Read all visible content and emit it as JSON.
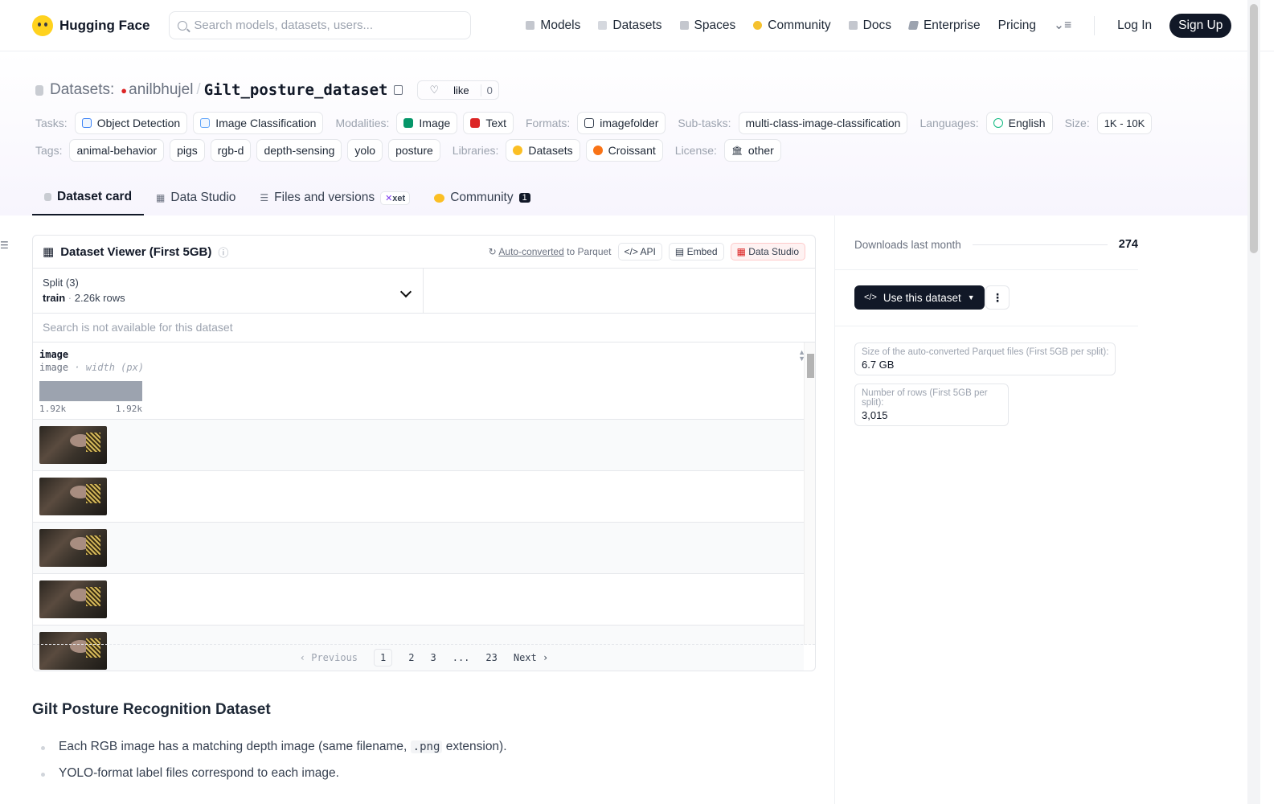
{
  "nav": {
    "brand": "Hugging Face",
    "search_placeholder": "Search models, datasets, users...",
    "links": [
      "Models",
      "Datasets",
      "Spaces",
      "Community",
      "Docs",
      "Enterprise",
      "Pricing"
    ],
    "login": "Log In",
    "signup": "Sign Up"
  },
  "header": {
    "section": "Datasets:",
    "owner": "anilbhujel",
    "separator": "/",
    "repo": "Gilt_posture_dataset",
    "like_label": "like",
    "like_count": "0"
  },
  "tags": {
    "tasks_label": "Tasks:",
    "tasks": [
      "Object Detection",
      "Image Classification"
    ],
    "modalities_label": "Modalities:",
    "modalities": [
      "Image",
      "Text"
    ],
    "formats_label": "Formats:",
    "format": "imagefolder",
    "subtasks_label": "Sub-tasks:",
    "subtask": "multi-class-image-classification",
    "languages_label": "Languages:",
    "language": "English",
    "size_label": "Size:",
    "size": "1K - 10K",
    "tags_label": "Tags:",
    "tags": [
      "animal-behavior",
      "pigs",
      "rgb-d",
      "depth-sensing",
      "yolo",
      "posture"
    ],
    "libraries_label": "Libraries:",
    "libraries": [
      "Datasets",
      "Croissant"
    ],
    "license_label": "License:",
    "license": "other"
  },
  "tabs": {
    "card": "Dataset card",
    "studio": "Data Studio",
    "files": "Files and versions",
    "xet": "xet",
    "community": "Community",
    "community_count": "1"
  },
  "viewer": {
    "title": "Dataset Viewer (First 5GB)",
    "autoconv": "Auto-converted",
    "autoconv_suffix": "to Parquet",
    "api": "API",
    "embed": "Embed",
    "studio": "Data Studio",
    "split_label": "Split (3)",
    "split_name": "train",
    "split_rows": "2.26k rows",
    "search_placeholder": "Search is not available for this dataset",
    "col_name": "image",
    "col_type": "image",
    "col_meta": "· width (px)",
    "hist_min": "1.92k",
    "hist_max": "1.92k",
    "pager": {
      "prev": "Previous",
      "pages": [
        "1",
        "2",
        "3",
        "...",
        "23"
      ],
      "next": "Next"
    }
  },
  "article": {
    "heading": "Gilt Posture Recognition Dataset",
    "bullet1_a": "Each RGB image has a matching depth image (same filename,",
    "bullet1_code": ".png",
    "bullet1_b": "extension).",
    "bullet2": "YOLO-format label files correspond to each image."
  },
  "sidebar": {
    "downloads_label": "Downloads last month",
    "downloads": "274",
    "use_label": "Use this dataset",
    "parquet_label": "Size of the auto-converted Parquet files (First 5GB per split):",
    "parquet_value": "6.7 GB",
    "rows_label": "Number of rows (First 5GB per split):",
    "rows_value": "3,015"
  }
}
